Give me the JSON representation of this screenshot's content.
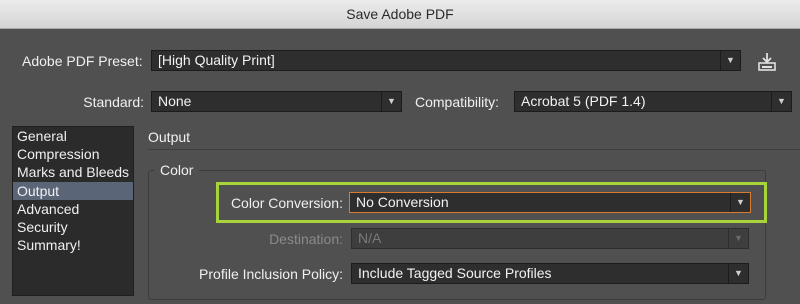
{
  "window": {
    "title": "Save Adobe PDF"
  },
  "preset": {
    "label": "Adobe PDF Preset:",
    "value": "[High Quality Print]",
    "save_icon": "save-preset-icon"
  },
  "standard": {
    "label": "Standard:",
    "value": "None"
  },
  "compatibility": {
    "label": "Compatibility:",
    "value": "Acrobat 5 (PDF 1.4)"
  },
  "sidebar": {
    "items": [
      {
        "label": "General"
      },
      {
        "label": "Compression"
      },
      {
        "label": "Marks and Bleeds"
      },
      {
        "label": "Output"
      },
      {
        "label": "Advanced"
      },
      {
        "label": "Security"
      },
      {
        "label": "Summary!"
      }
    ],
    "selected": "Output"
  },
  "main": {
    "section_title": "Output",
    "color_group": {
      "title": "Color",
      "color_conversion": {
        "label": "Color Conversion:",
        "value": "No Conversion"
      },
      "destination": {
        "label": "Destination:",
        "value": "N/A"
      },
      "profile_policy": {
        "label": "Profile Inclusion Policy:",
        "value": "Include Tagged Source Profiles"
      }
    }
  },
  "colors": {
    "background": "#505050",
    "highlight_outline": "#a7d43a",
    "focus_ring": "#d87a34",
    "selected_item": "#5a6677"
  }
}
